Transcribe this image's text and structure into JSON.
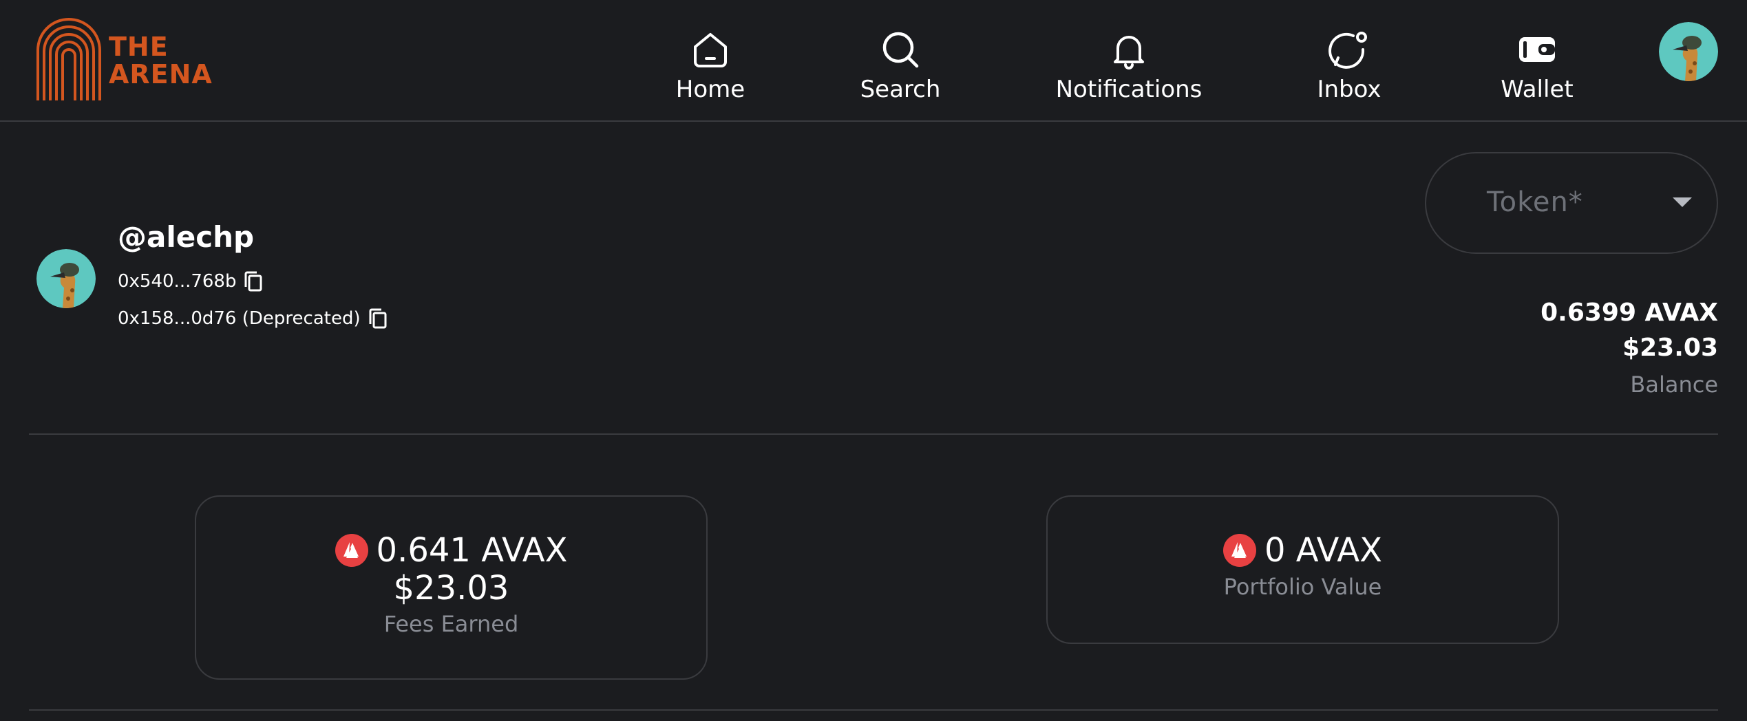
{
  "brand": {
    "logo_line1": "THE",
    "logo_line2": "ARENA",
    "logo_color": "#d4561f"
  },
  "nav": {
    "items": [
      {
        "label": "Home",
        "icon": "home-icon"
      },
      {
        "label": "Search",
        "icon": "search-icon"
      },
      {
        "label": "Notifications",
        "icon": "bell-icon"
      },
      {
        "label": "Inbox",
        "icon": "chat-icon"
      },
      {
        "label": "Wallet",
        "icon": "wallet-icon"
      }
    ]
  },
  "profile": {
    "handle": "@alechp",
    "address_primary": "0x540...768b",
    "address_deprecated": "0x158...0d76 (Deprecated)"
  },
  "token_select": {
    "placeholder": "Token*"
  },
  "balance": {
    "avax": "0.6399 AVAX",
    "usd": "$23.03",
    "label": "Balance"
  },
  "cards": {
    "fees": {
      "avax": "0.641 AVAX",
      "usd": "$23.03",
      "label": "Fees Earned"
    },
    "portfolio": {
      "avax": "0 AVAX",
      "label": "Portfolio Value"
    }
  },
  "colors": {
    "background": "#1b1c1f",
    "border": "#3a3b3f",
    "muted_text": "#8a8d95",
    "avax_red": "#e84142"
  }
}
